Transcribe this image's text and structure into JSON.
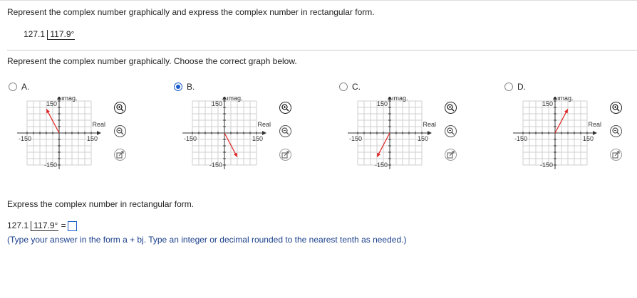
{
  "question": {
    "title": "Represent the complex number graphically and express the complex number in rectangular form.",
    "magnitude": "127.1",
    "angle": "117.9°",
    "sub_prompt": "Represent the complex number graphically. Choose the correct graph below."
  },
  "options": [
    {
      "label": "A.",
      "selected": false,
      "quadrant": 2
    },
    {
      "label": "B.",
      "selected": true,
      "quadrant": 4
    },
    {
      "label": "C.",
      "selected": false,
      "quadrant": 3
    },
    {
      "label": "D.",
      "selected": false,
      "quadrant": 1
    }
  ],
  "graph": {
    "imag_label": "Imag.",
    "real_label": "Real",
    "tick_pos": "150",
    "tick_neg": "-150",
    "grid_steps": 10,
    "axis_max": 150,
    "arrow_color": "#e02020",
    "angle_magnitude_deg": 62.1
  },
  "tools": {
    "zoom_in_icon": "zoom-in-icon",
    "zoom_out_icon": "zoom-out-icon",
    "popout_icon": "popout-icon"
  },
  "answer": {
    "prompt": "Express the complex number in rectangular form.",
    "equals": "=",
    "value": "",
    "hint": "(Type your answer in the form a + bj. Type an integer or decimal rounded to the nearest tenth as needed.)"
  },
  "colors": {
    "accent": "#1a5cc8",
    "hint": "#1a3f8a"
  }
}
